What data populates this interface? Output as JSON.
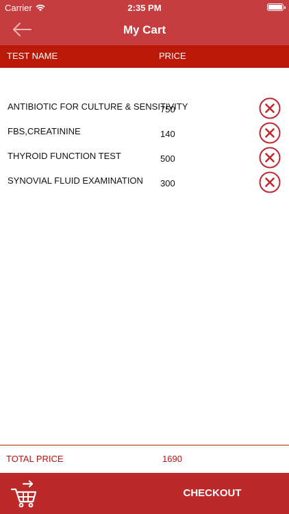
{
  "status_bar": {
    "carrier": "Carrier",
    "time": "2:35 PM"
  },
  "nav": {
    "title": "My Cart",
    "back_icon": "arrow-left-icon"
  },
  "table_header": {
    "name_label": "TEST NAME",
    "price_label": "PRICE"
  },
  "items": [
    {
      "name": "ANTIBIOTIC FOR CULTURE & SENSITIVITY",
      "price": "750"
    },
    {
      "name": "FBS,CREATININE",
      "price": "140"
    },
    {
      "name": "THYROID FUNCTION TEST",
      "price": "500"
    },
    {
      "name": "SYNOVIAL FLUID EXAMINATION",
      "price": "300"
    }
  ],
  "total": {
    "label": "TOTAL PRICE",
    "value": "1690"
  },
  "bottom_bar": {
    "checkout_label": "CHECKOUT",
    "cart_icon": "cart-icon"
  },
  "colors": {
    "nav_bar": "#c53d3f",
    "header_bar": "#bb1a09",
    "accent": "#b5120f",
    "remove_icon": "#c0272d",
    "bottom_bar": "#bd2828"
  }
}
